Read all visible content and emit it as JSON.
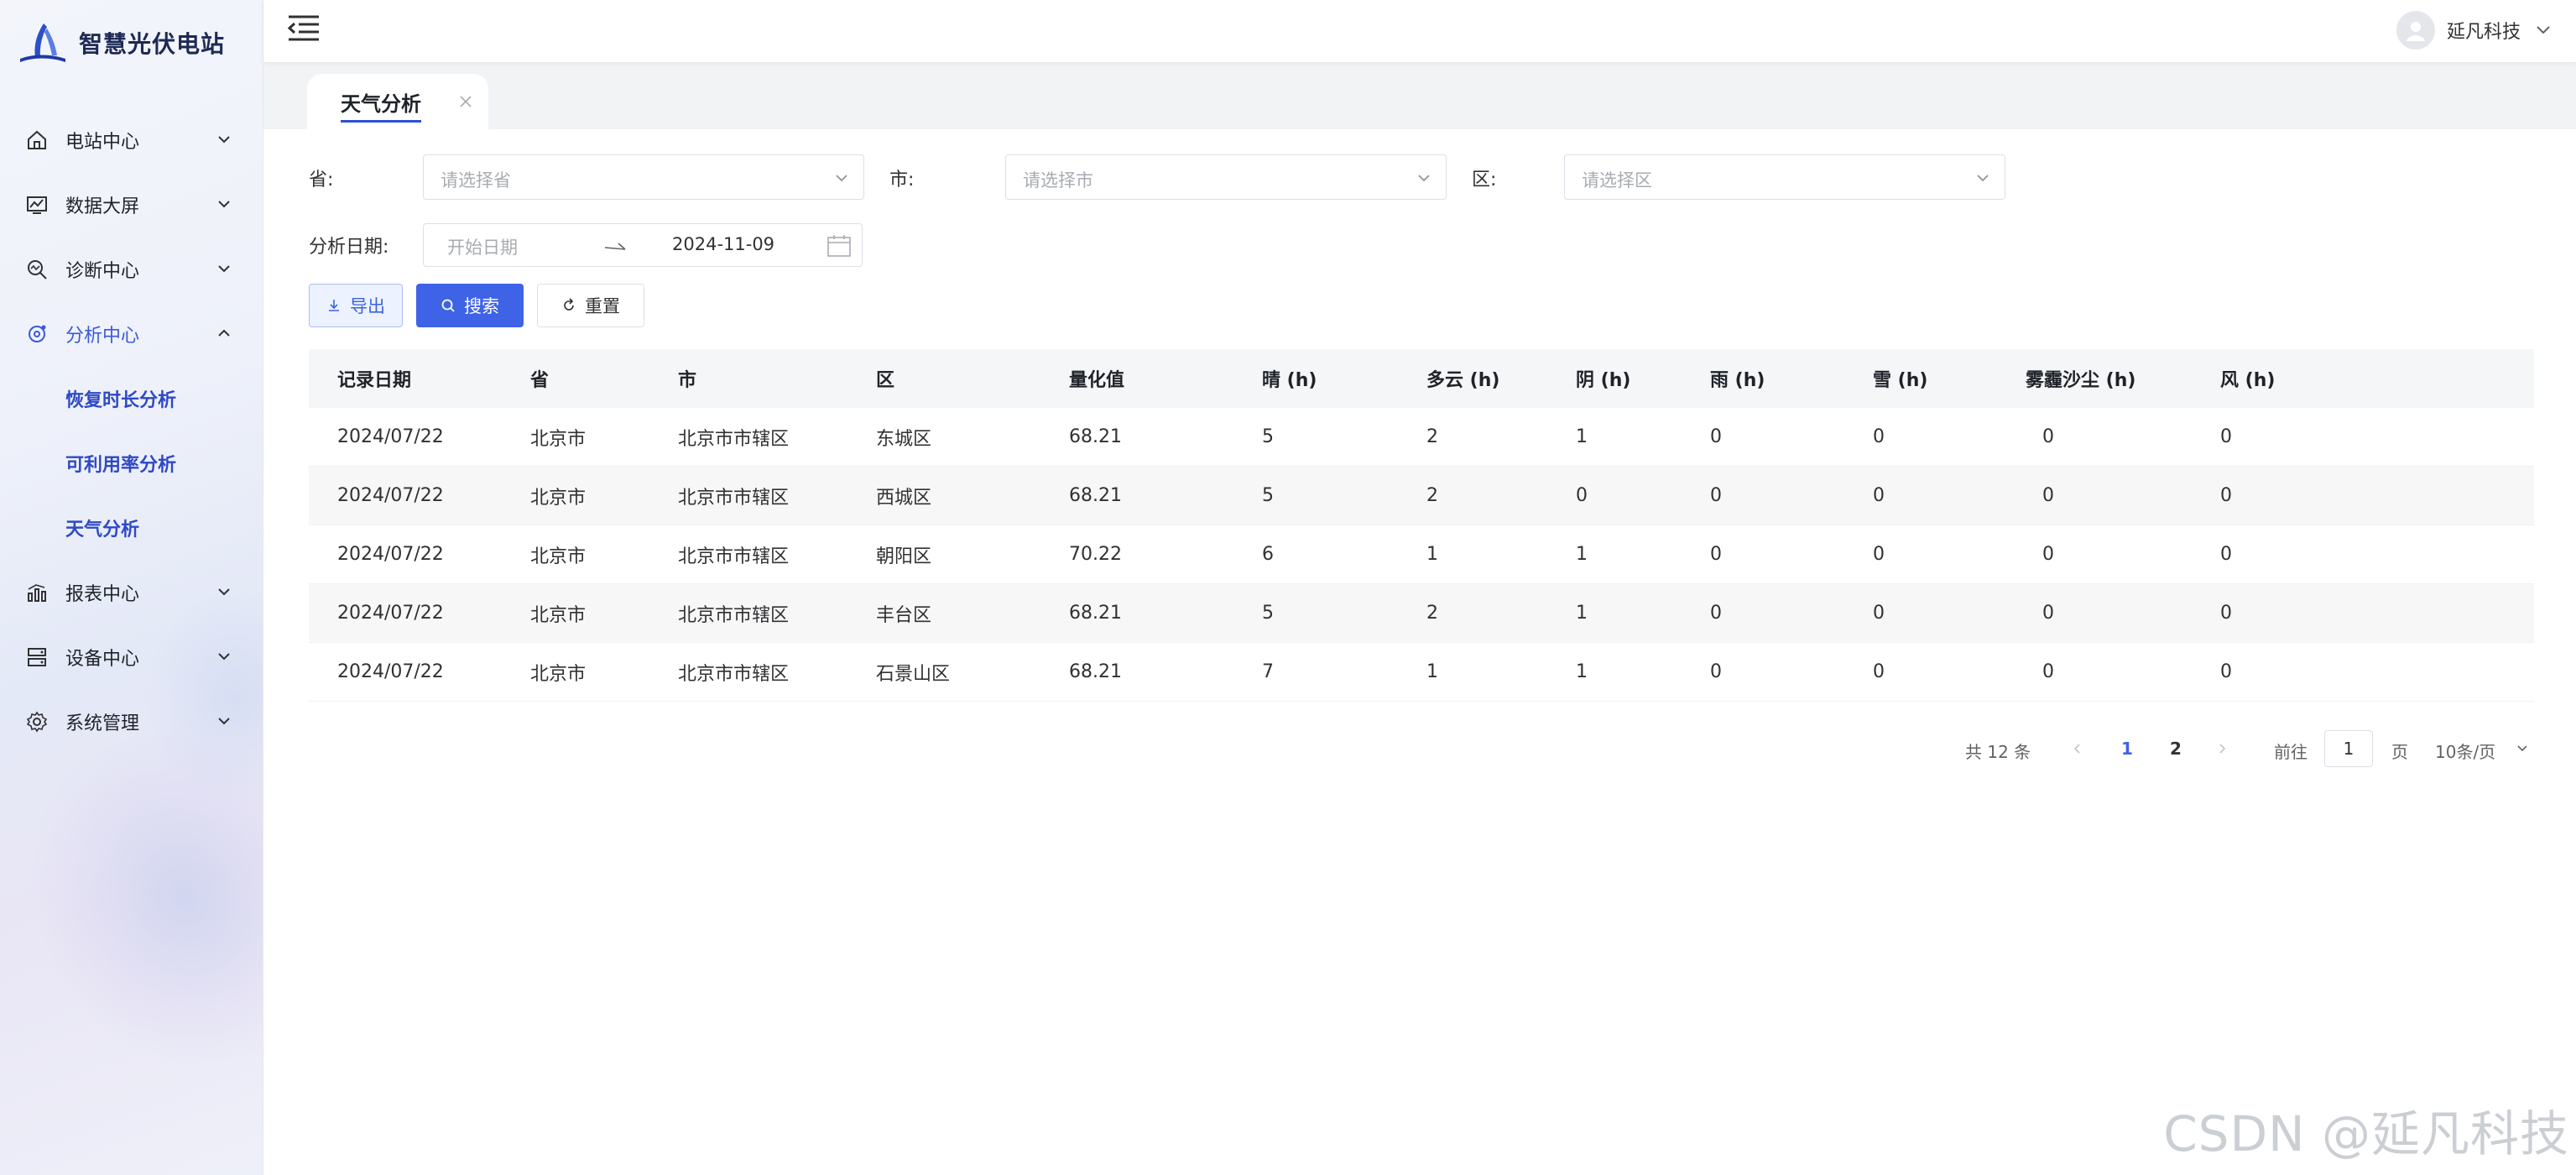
{
  "brand": {
    "name": "智慧光伏电站"
  },
  "sidebar": {
    "items": [
      {
        "label": "电站中心",
        "icon": "home-icon"
      },
      {
        "label": "数据大屏",
        "icon": "monitor-chart-icon"
      },
      {
        "label": "诊断中心",
        "icon": "search-diagnose-icon"
      },
      {
        "label": "分析中心",
        "icon": "analysis-icon",
        "expanded": true,
        "children": [
          "恢复时长分析",
          "可利用率分析",
          "天气分析"
        ]
      },
      {
        "label": "报表中心",
        "icon": "report-chart-icon"
      },
      {
        "label": "设备中心",
        "icon": "device-icon"
      },
      {
        "label": "系统管理",
        "icon": "gear-icon"
      }
    ]
  },
  "header": {
    "user_name": "延凡科技"
  },
  "tabs": [
    {
      "label": "天气分析",
      "active": true
    }
  ],
  "filters": {
    "province_label": "省:",
    "province_placeholder": "请选择省",
    "city_label": "市:",
    "city_placeholder": "请选择市",
    "district_label": "区:",
    "district_placeholder": "请选择区",
    "date_label": "分析日期:",
    "date_start_placeholder": "开始日期",
    "date_end_value": "2024-11-09"
  },
  "buttons": {
    "export": "导出",
    "search": "搜索",
    "reset": "重置"
  },
  "table": {
    "columns": [
      "记录日期",
      "省",
      "市",
      "区",
      "量化值",
      "晴 (h)",
      "多云 (h)",
      "阴 (h)",
      "雨 (h)",
      "雪 (h)",
      "雾霾沙尘 (h)",
      "风 (h)"
    ],
    "rows": [
      [
        "2024/07/22",
        "北京市",
        "北京市市辖区",
        "东城区",
        "68.21",
        "5",
        "2",
        "1",
        "0",
        "0",
        "0",
        "0"
      ],
      [
        "2024/07/22",
        "北京市",
        "北京市市辖区",
        "西城区",
        "68.21",
        "5",
        "2",
        "0",
        "0",
        "0",
        "0",
        "0"
      ],
      [
        "2024/07/22",
        "北京市",
        "北京市市辖区",
        "朝阳区",
        "70.22",
        "6",
        "1",
        "1",
        "0",
        "0",
        "0",
        "0"
      ],
      [
        "2024/07/22",
        "北京市",
        "北京市市辖区",
        "丰台区",
        "68.21",
        "5",
        "2",
        "1",
        "0",
        "0",
        "0",
        "0"
      ],
      [
        "2024/07/22",
        "北京市",
        "北京市市辖区",
        "石景山区",
        "68.21",
        "7",
        "1",
        "1",
        "0",
        "0",
        "0",
        "0"
      ]
    ]
  },
  "pagination": {
    "total_text": "共 12 条",
    "pages": [
      "1",
      "2"
    ],
    "current_page": "1",
    "goto_label": "前往",
    "goto_value": "1",
    "page_suffix": "页",
    "page_size": "10条/页"
  },
  "watermark": "CSDN @延凡科技",
  "colors": {
    "accent": "#3e63e6",
    "active_text": "#2f49c5",
    "sidebar_bg": "#eef1fa"
  }
}
